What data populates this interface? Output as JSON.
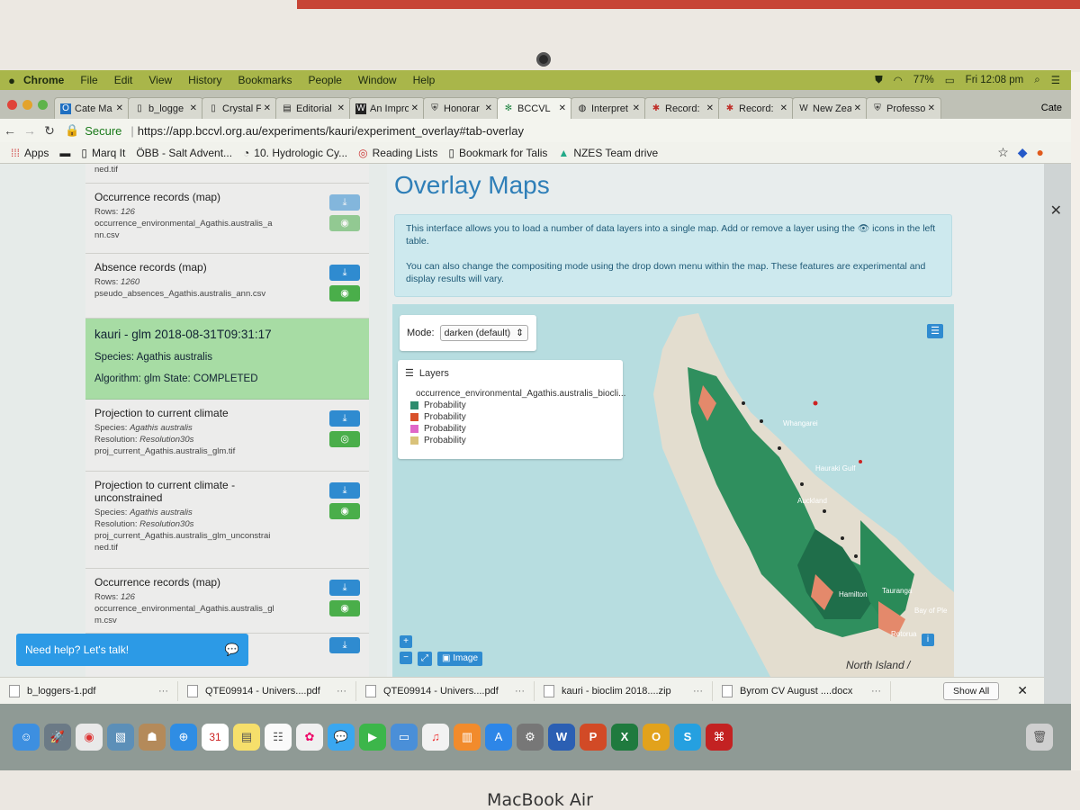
{
  "menubar": {
    "apple": "",
    "items": [
      "Chrome",
      "File",
      "Edit",
      "View",
      "History",
      "Bookmarks",
      "People",
      "Window",
      "Help"
    ],
    "battery": "77%",
    "clock": "Fri 12:08 pm"
  },
  "tabs": [
    {
      "label": "Cate Ma",
      "icon": "outlook-icon"
    },
    {
      "label": "b_logge",
      "icon": "doc-icon"
    },
    {
      "label": "Crystal F",
      "icon": "doc-icon"
    },
    {
      "label": "Editorial",
      "icon": "editorial-icon"
    },
    {
      "label": "An Impro",
      "icon": "w-icon"
    },
    {
      "label": "Honorar",
      "icon": "shield-icon"
    },
    {
      "label": "BCCVL",
      "icon": "bccvl-icon"
    },
    {
      "label": "Interpret",
      "icon": "chart-icon"
    },
    {
      "label": "Record:",
      "icon": "record-icon"
    },
    {
      "label": "Record:",
      "icon": "record-icon"
    },
    {
      "label": "New Zea",
      "icon": "w-icon"
    },
    {
      "label": "Professo",
      "icon": "shield-icon"
    }
  ],
  "profile_name": "Cate",
  "address": {
    "secure_label": "Secure",
    "url": "https://app.bccvl.org.au/experiments/kauri/experiment_overlay#tab-overlay"
  },
  "bookmarks": [
    "Apps",
    "Marq It",
    "ÖBB - Salt Advent...",
    "10. Hydrologic Cy...",
    "Reading Lists",
    "Bookmark for Talis",
    "NZES Team drive"
  ],
  "sidebar": {
    "truncated_file": "ned.tif",
    "cards_top": [
      {
        "title": "Occurrence records (map)",
        "rows_label": "Rows:",
        "rows": "126",
        "file": "occurrence_environmental_Agathis.australis_a nn.csv"
      },
      {
        "title": "Absence records (map)",
        "rows_label": "Rows:",
        "rows": "1260",
        "file": "pseudo_absences_Agathis.australis_ann.csv"
      }
    ],
    "result": {
      "title": "kauri - glm 2018-08-31T09:31:17",
      "species": "Species: Agathis australis",
      "algorithm": "Algorithm: glm State: COMPLETED"
    },
    "cards_bottom": [
      {
        "title": "Projection to current climate",
        "species_label": "Species:",
        "species": "Agathis australis",
        "res_label": "Resolution:",
        "res": "Resolution30s",
        "file": "proj_current_Agathis.australis_glm.tif"
      },
      {
        "title": "Projection to current climate - unconstrained",
        "species_label": "Species:",
        "species": "Agathis australis",
        "res_label": "Resolution:",
        "res": "Resolution30s",
        "file": "proj_current_Agathis.australis_glm_unconstrai ned.tif"
      },
      {
        "title": "Occurrence records (map)",
        "rows_label": "Rows:",
        "rows": "126",
        "file": "occurrence_environmental_Agathis.australis_gl m.csv"
      }
    ],
    "help": "Need help? Let's talk!"
  },
  "main": {
    "title": "Overlay Maps",
    "info_p1": "This interface allows you to load a number of data layers into a single map. Add or remove a layer using the 👁 icons in the left table.",
    "info_p2": "You can also change the compositing mode using the drop down menu within the map. These features are experimental and display results will vary.",
    "mode_label": "Mode:",
    "mode_value": "darken (default)",
    "layers_title": "Layers",
    "layers": [
      {
        "label": "occurrence_environmental_Agathis.australis_biocli...",
        "color": "#d22222",
        "kind": "dot"
      },
      {
        "label": "Probability",
        "color": "#2e8c6e",
        "kind": "swatch"
      },
      {
        "label": "Probability",
        "color": "#d9502a",
        "kind": "swatch"
      },
      {
        "label": "Probability",
        "color": "#e066c8",
        "kind": "swatch"
      },
      {
        "label": "Probability",
        "color": "#d9c27a",
        "kind": "swatch"
      }
    ],
    "image_button": "Image",
    "map_places": [
      "Whangarei",
      "Hauraki Gulf",
      "Auckland",
      "Hamilton",
      "Tauranga",
      "Bay of Ple",
      "Rotorua"
    ],
    "north_island": "North Island /"
  },
  "downloads": [
    {
      "name": "b_loggers-1.pdf"
    },
    {
      "name": "QTE09914 - Univers....pdf"
    },
    {
      "name": "QTE09914 - Univers....pdf"
    },
    {
      "name": "kauri - bioclim 2018....zip"
    },
    {
      "name": "Byrom CV August ....docx"
    }
  ],
  "downloads_show_all": "Show All",
  "dock_icons": [
    "finder",
    "launchpad",
    "chrome",
    "preview",
    "contacts",
    "safari",
    "calendar",
    "notes",
    "reminders",
    "photos",
    "messages",
    "facetime",
    "keynote",
    "music",
    "books",
    "appstore",
    "settings",
    "word",
    "powerpoint",
    "excel",
    "outlook",
    "skype",
    "acrobat",
    "trash"
  ],
  "dock_calendar_date": "31",
  "brand": "MacBook Air"
}
